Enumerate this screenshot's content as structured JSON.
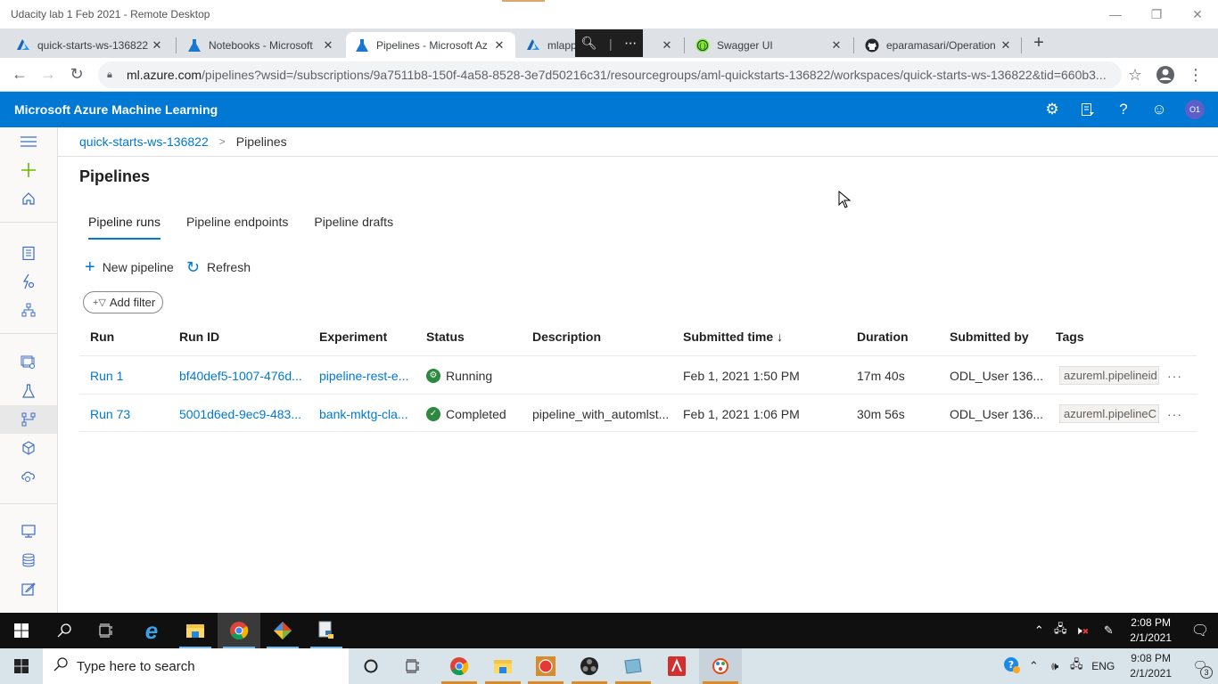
{
  "remote_desktop": {
    "title": "Udacity lab 1 Feb 2021 - Remote Desktop"
  },
  "browser": {
    "tabs": [
      {
        "title": "quick-starts-ws-136822",
        "icon": "azure-icon",
        "active": false
      },
      {
        "title": "Notebooks - Microsoft",
        "icon": "azure-ml-flask-icon",
        "active": false
      },
      {
        "title": "Pipelines - Microsoft Az",
        "icon": "azure-ml-flask-icon",
        "active": true
      },
      {
        "title": "mlapp",
        "icon": "azure-icon",
        "active": false
      },
      {
        "title": "Swagger UI",
        "icon": "swagger-icon",
        "active": false
      },
      {
        "title": "eparamasari/Operation",
        "icon": "github-icon",
        "active": false
      }
    ],
    "url_host": "ml.azure.com",
    "url_path": "/pipelines?wsid=/subscriptions/9a7511b8-150f-4a58-8528-3e7d50216c31/resourcegroups/aml-quickstarts-136822/workspaces/quick-starts-ws-136822&tid=660b3..."
  },
  "azure": {
    "brand": "Microsoft Azure Machine Learning",
    "avatar_initials": "O1",
    "accent": "#0078d4"
  },
  "breadcrumb": {
    "workspace": "quick-starts-ws-136822",
    "current": "Pipelines"
  },
  "page": {
    "title": "Pipelines",
    "tabs": [
      "Pipeline runs",
      "Pipeline endpoints",
      "Pipeline drafts"
    ],
    "active_tab": "Pipeline runs",
    "commands": {
      "new_pipeline": "New pipeline",
      "refresh": "Refresh",
      "add_filter": "Add filter"
    }
  },
  "table": {
    "columns": [
      "Run",
      "Run ID",
      "Experiment",
      "Status",
      "Description",
      "Submitted time ↓",
      "Duration",
      "Submitted by",
      "Tags"
    ],
    "rows": [
      {
        "run": "Run 1",
        "run_id": "bf40def5-1007-476d...",
        "experiment": "pipeline-rest-e...",
        "status": "Running",
        "description": "",
        "submitted_time": "Feb 1, 2021 1:50 PM",
        "duration": "17m 40s",
        "submitted_by": "ODL_User 136...",
        "tags": "azureml.pipelineid"
      },
      {
        "run": "Run 73",
        "run_id": "5001d6ed-9ec9-483...",
        "experiment": "bank-mktg-cla...",
        "status": "Completed",
        "description": "pipeline_with_automlst...",
        "submitted_time": "Feb 1, 2021 1:06 PM",
        "duration": "30m 56s",
        "submitted_by": "ODL_User 136...",
        "tags": "azureml.pipelineC"
      }
    ]
  },
  "taskbar_inner": {
    "time": "2:08 PM",
    "date": "2/1/2021"
  },
  "taskbar_outer": {
    "search_placeholder": "Type here to search",
    "language": "ENG",
    "time": "9:08 PM",
    "date": "2/1/2021",
    "notification_count": "3"
  }
}
